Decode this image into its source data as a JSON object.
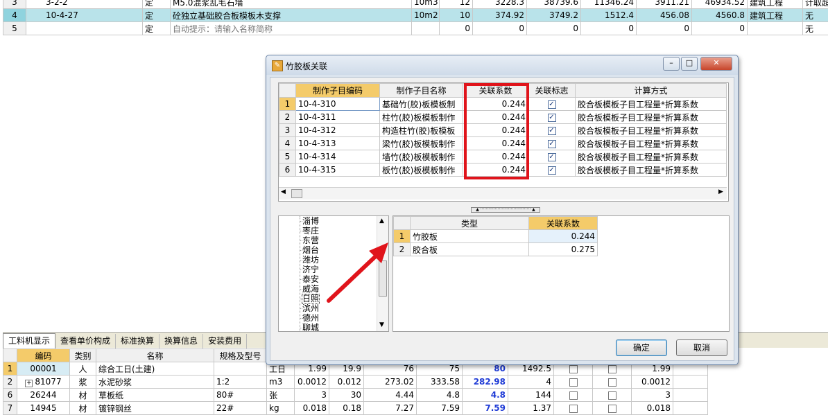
{
  "top_grid": {
    "rows": [
      {
        "idx": "3",
        "code": "3-2-2",
        "type": "定",
        "name": "M5.0混浆乱毛石墙",
        "unit": "10m3",
        "qty": "12",
        "c1": "3228.3",
        "c2": "38739.6",
        "c3": "11346.24",
        "c4": "3911.21",
        "c5": "46934.52",
        "cat": "建筑工程",
        "extra": "计取超"
      },
      {
        "idx": "4",
        "code": "10-4-27",
        "type": "定",
        "name": "砼独立基础胶合板模板木支撑",
        "unit": "10m2",
        "qty": "10",
        "c1": "374.92",
        "c2": "3749.2",
        "c3": "1512.4",
        "c4": "456.08",
        "c5": "4560.8",
        "cat": "建筑工程",
        "extra": "无"
      },
      {
        "idx": "5",
        "code": "",
        "type": "定",
        "name": "自动提示：请输入名称简称",
        "unit": "",
        "qty": "0",
        "c1": "0",
        "c2": "0",
        "c3": "0",
        "c4": "0",
        "c5": "0",
        "cat": "",
        "extra": "无"
      }
    ]
  },
  "bottom_tabs": [
    "工料机显示",
    "查看单价构成",
    "标准换算",
    "换算信息",
    "安装费用"
  ],
  "bottom_grid": {
    "headers": [
      "编码",
      "类别",
      "名称",
      "规格及型号"
    ],
    "rows": [
      {
        "idx": "1",
        "code": "00001",
        "type": "人",
        "name": "综合工日(土建)",
        "spec": "",
        "unit": "工日",
        "v1": "1.99",
        "v2": "19.9",
        "v3": "76",
        "v4": "75",
        "v5": "80",
        "v6": "1492.5",
        "v7": "1.99"
      },
      {
        "idx": "2",
        "code": "81077",
        "type": "浆",
        "name": "水泥砂浆",
        "spec": "1:2",
        "unit": "m3",
        "v1": "0.0012",
        "v2": "0.012",
        "v3": "273.02",
        "v4": "333.58",
        "v5": "282.98",
        "v6": "4",
        "v7": "0.0012"
      },
      {
        "idx": "6",
        "code": "26244",
        "type": "材",
        "name": "草板纸",
        "spec": "80#",
        "unit": "张",
        "v1": "3",
        "v2": "30",
        "v3": "4.44",
        "v4": "4.8",
        "v5": "4.8",
        "v6": "144",
        "v7": "3"
      },
      {
        "idx": "7",
        "code": "14945",
        "type": "材",
        "name": "镀锌钢丝",
        "spec": "22#",
        "unit": "kg",
        "v1": "0.018",
        "v2": "0.18",
        "v3": "7.27",
        "v4": "7.59",
        "v5": "7.59",
        "v6": "1.37",
        "v7": "0.018"
      }
    ]
  },
  "dialog": {
    "title": "竹胶板关联",
    "assoc_headers": [
      "制作子目编码",
      "制作子目名称",
      "关联系数",
      "关联标志",
      "计算方式"
    ],
    "assoc_rows": [
      {
        "idx": "1",
        "code": "10-4-310",
        "name": "基础竹(胶)板模板制",
        "coef": "0.244",
        "method": "胶合板模板子目工程量*折算系数"
      },
      {
        "idx": "2",
        "code": "10-4-311",
        "name": "柱竹(胶)板模板制作",
        "coef": "0.244",
        "method": "胶合板模板子目工程量*折算系数"
      },
      {
        "idx": "3",
        "code": "10-4-312",
        "name": "构造柱竹(胶)板模板",
        "coef": "0.244",
        "method": "胶合板模板子目工程量*折算系数"
      },
      {
        "idx": "4",
        "code": "10-4-313",
        "name": "梁竹(胶)板模板制作",
        "coef": "0.244",
        "method": "胶合板模板子目工程量*折算系数"
      },
      {
        "idx": "5",
        "code": "10-4-314",
        "name": "墙竹(胶)板模板制作",
        "coef": "0.244",
        "method": "胶合板模板子目工程量*折算系数"
      },
      {
        "idx": "6",
        "code": "10-4-315",
        "name": "板竹(胶)板模板制作",
        "coef": "0.244",
        "method": "胶合板模板子目工程量*折算系数"
      }
    ],
    "tree_items": [
      "淄博",
      "枣庄",
      "东营",
      "烟台",
      "潍坊",
      "济宁",
      "泰安",
      "威海",
      "日照",
      "滨州",
      "德州",
      "聊城"
    ],
    "type_headers": [
      "类型",
      "关联系数"
    ],
    "type_rows": [
      {
        "idx": "1",
        "type": "竹胶板",
        "coef": "0.244"
      },
      {
        "idx": "2",
        "type": "胶合板",
        "coef": "0.275"
      }
    ],
    "ok_label": "确定",
    "cancel_label": "取消"
  },
  "colors": {
    "highlight_red": "#e0141b",
    "header_orange": "#f4cb6a",
    "selected_row": "#b9e3ea"
  }
}
